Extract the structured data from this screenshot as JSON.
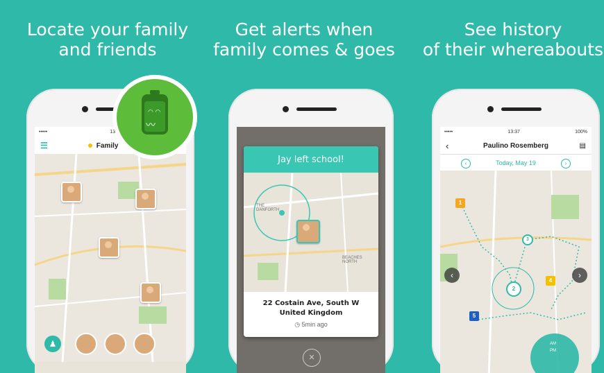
{
  "panels": [
    {
      "title_line1": "Locate your family",
      "title_line2": "and friends",
      "status_time": "13:3",
      "status_carrier": "•••••",
      "nav_title": "Family"
    },
    {
      "title_line1": "Get alerts when",
      "title_line2": "family comes & goes",
      "alert_title": "Jay left school!",
      "map_label_area1": "THE DANFORTH",
      "map_label_area2": "BEACHES NORTH",
      "address_line1": "22 Costain Ave, South W",
      "address_line2": "United Kingdom",
      "time_ago": "5min ago"
    },
    {
      "title_line1": "See history",
      "title_line2": "of their whereabouts",
      "status_time": "13:37",
      "status_carrier": "•••••",
      "status_battery": "100%",
      "nav_title": "Paulino Rosemberg",
      "date_label": "Today, May 19",
      "markers": [
        "1",
        "4",
        "5"
      ],
      "nodes": [
        "2",
        "3"
      ],
      "clock_am": "AM",
      "clock_pm": "PM"
    }
  ],
  "colors": {
    "background": "#2fb9a8",
    "battery_badge": "#5dbd3b",
    "marker_orange": "#f5a623",
    "marker_yellow": "#f2c200",
    "marker_blue": "#1f5fc4"
  }
}
